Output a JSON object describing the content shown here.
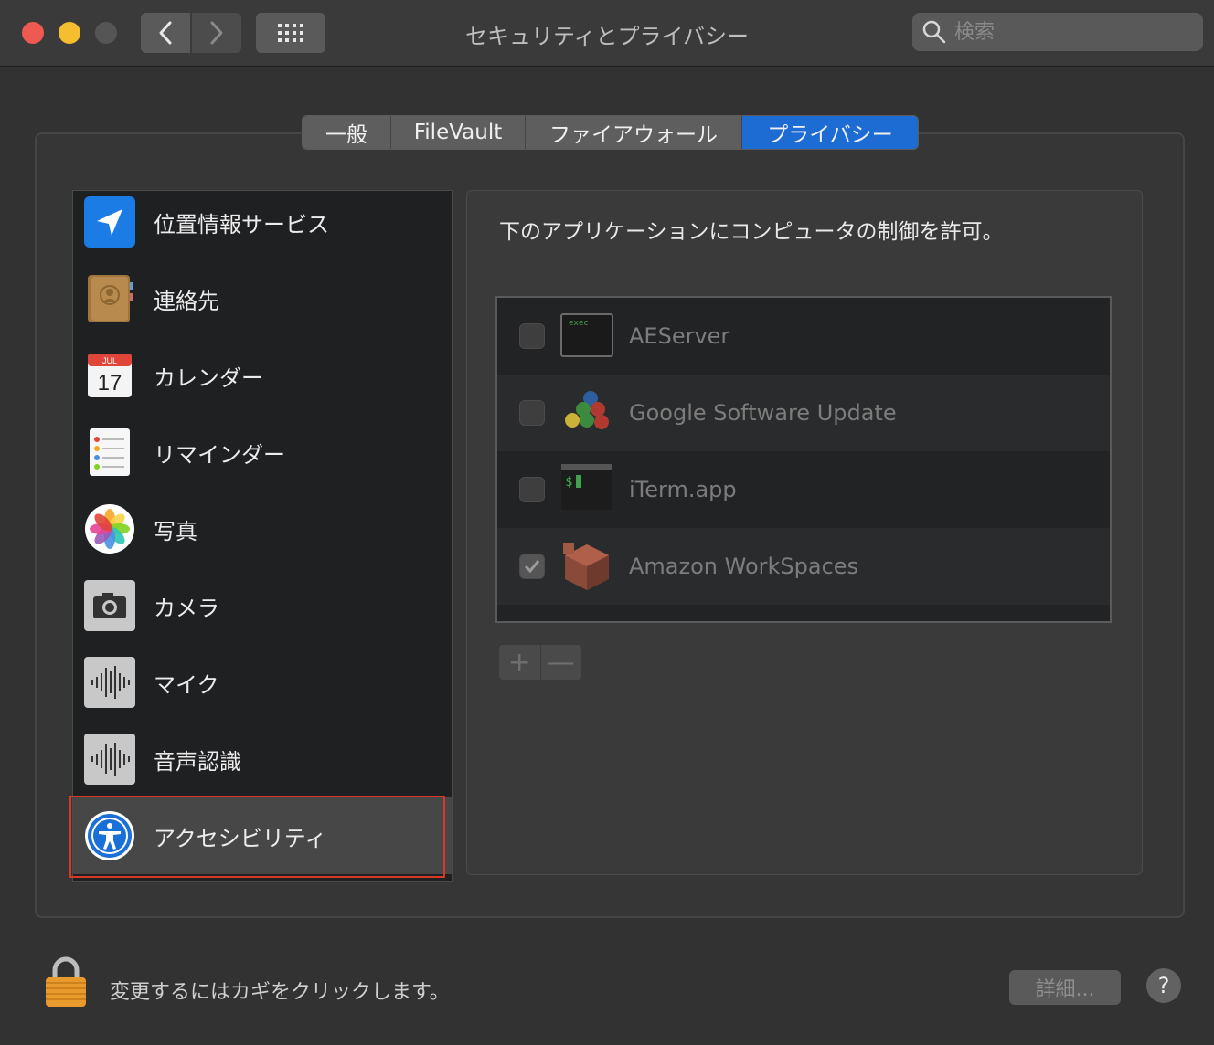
{
  "window": {
    "title": "セキュリティとプライバシー",
    "search_placeholder": "検索"
  },
  "tabs": [
    "一般",
    "FileVault",
    "ファイアウォール",
    "プライバシー"
  ],
  "active_tab": "プライバシー",
  "sidebar": {
    "items": [
      {
        "label": "位置情報サービス",
        "icon": "location-arrow-icon"
      },
      {
        "label": "連絡先",
        "icon": "contacts-book-icon"
      },
      {
        "label": "カレンダー",
        "icon": "calendar-icon",
        "icon_month": "JUL",
        "icon_day": "17"
      },
      {
        "label": "リマインダー",
        "icon": "reminders-icon"
      },
      {
        "label": "写真",
        "icon": "photos-icon"
      },
      {
        "label": "カメラ",
        "icon": "camera-icon"
      },
      {
        "label": "マイク",
        "icon": "microphone-waveform-icon"
      },
      {
        "label": "音声認識",
        "icon": "speech-recognition-icon"
      },
      {
        "label": "アクセシビリティ",
        "icon": "accessibility-icon"
      }
    ],
    "selected": "アクセシビリティ"
  },
  "pane": {
    "header": "下のアプリケーションにコンピュータの制御を許可。",
    "apps": [
      {
        "name": "AEServer",
        "checked": false,
        "icon": "exec-terminal-icon",
        "icon_text": "exec"
      },
      {
        "name": "Google Software Update",
        "checked": false,
        "icon": "google-update-balls-icon"
      },
      {
        "name": "iTerm.app",
        "checked": false,
        "icon": "iterm-icon",
        "icon_text": "$"
      },
      {
        "name": "Amazon WorkSpaces",
        "checked": true,
        "icon": "amazon-workspaces-cube-icon"
      }
    ],
    "add_label": "+",
    "remove_label": "—"
  },
  "footer": {
    "lock_text": "変更するにはカギをクリックします。",
    "details_label": "詳細...",
    "help_label": "?"
  },
  "colors": {
    "accent": "#1d6cd4",
    "highlight_border": "#d63a27"
  }
}
